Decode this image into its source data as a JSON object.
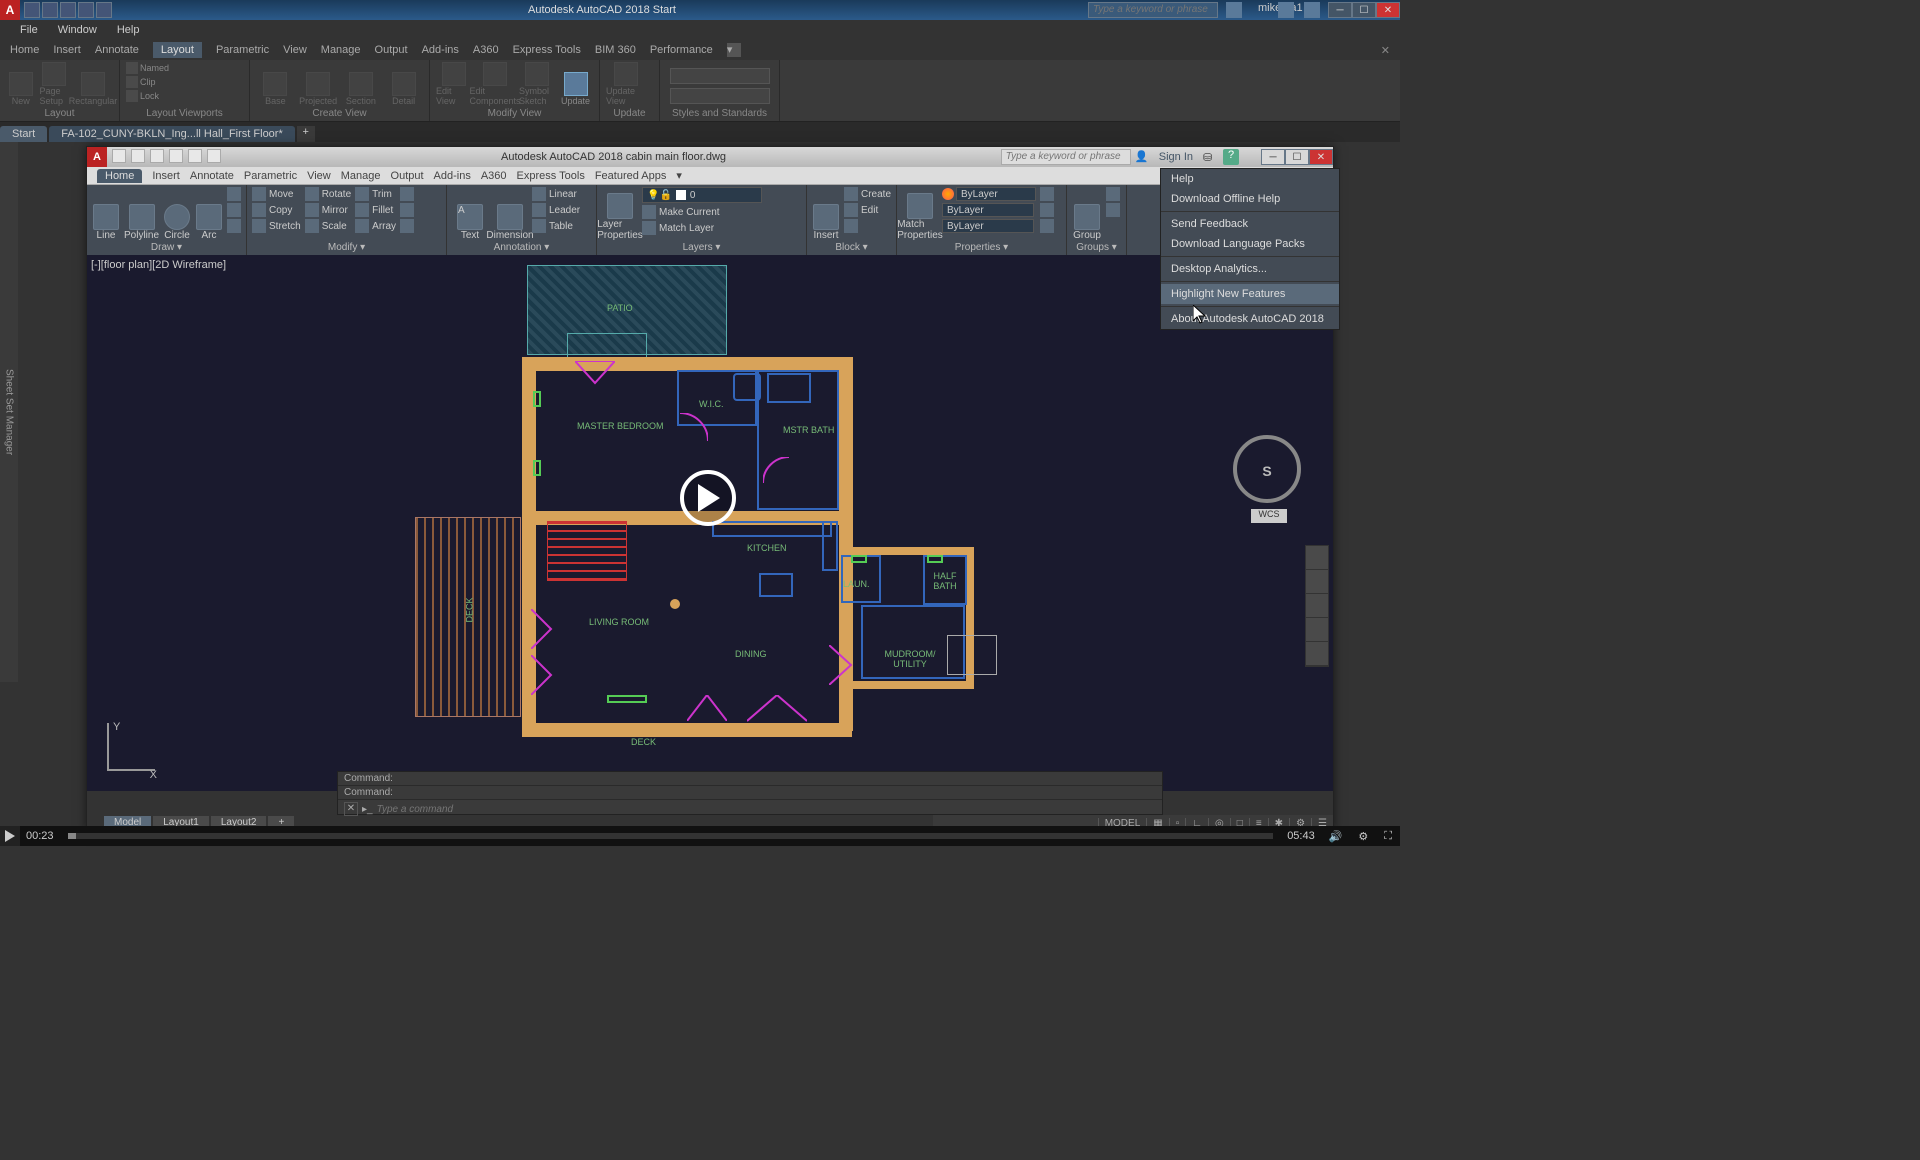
{
  "outer": {
    "title": "Autodesk AutoCAD 2018   Start",
    "search_ph": "Type a keyword or phrase",
    "user": "mikeafa1",
    "menus": [
      "File",
      "Window",
      "Help"
    ],
    "ribbon_tabs": [
      "Home",
      "Insert",
      "Annotate",
      "Layout",
      "Parametric",
      "View",
      "Manage",
      "Output",
      "Add-ins",
      "A360",
      "Express Tools",
      "BIM 360",
      "Performance"
    ],
    "ribbon_active": "Layout",
    "panels": {
      "layout": {
        "label": "Layout",
        "buttons": [
          "New",
          "Page Setup",
          "Rectangular"
        ]
      },
      "viewports": {
        "label": "Layout Viewports",
        "buttons": [
          "Clip",
          "Lock",
          "Named"
        ]
      },
      "createview": {
        "label": "Create View",
        "buttons": [
          "Base",
          "Projected",
          "Section",
          "Detail"
        ]
      },
      "modifyview": {
        "label": "Modify View",
        "buttons": [
          "Edit View",
          "Edit Components",
          "Symbol Sketch",
          "Update"
        ]
      },
      "update": {
        "label": "Update",
        "buttons": [
          "Update View"
        ]
      },
      "styles": {
        "label": "Styles and Standards"
      }
    },
    "doctabs": [
      "Start",
      "FA-102_CUNY-BKLN_Ing...ll Hall_First Floor*"
    ],
    "ssm": "Sheet Set Manager"
  },
  "inner": {
    "title": "Autodesk AutoCAD 2018      cabin main floor.dwg",
    "search_ph": "Type a keyword or phrase",
    "signin": "Sign In",
    "ribbon_tabs": [
      "Home",
      "Insert",
      "Annotate",
      "Parametric",
      "View",
      "Manage",
      "Output",
      "Add-ins",
      "A360",
      "Express Tools",
      "Featured Apps"
    ],
    "ribbon_active": "Home",
    "panels": {
      "draw": {
        "label": "Draw",
        "buttons": [
          "Line",
          "Polyline",
          "Circle",
          "Arc"
        ]
      },
      "modify": {
        "label": "Modify",
        "move": "Move",
        "copy": "Copy",
        "stretch": "Stretch",
        "rotate": "Rotate",
        "mirror": "Mirror",
        "scale": "Scale",
        "trim": "Trim",
        "fillet": "Fillet",
        "array": "Array"
      },
      "annotation": {
        "label": "Annotation",
        "text": "Text",
        "dim": "Dimension",
        "linear": "Linear",
        "leader": "Leader",
        "table": "Table"
      },
      "layers": {
        "label": "Layers",
        "big": "Layer Properties",
        "layer0": "0",
        "makecur": "Make Current",
        "matchlyr": "Match Layer"
      },
      "block": {
        "label": "Block",
        "insert": "Insert",
        "create": "Create",
        "edit": "Edit"
      },
      "properties": {
        "label": "Properties",
        "match": "Match Properties",
        "bylayer": "ByLayer"
      },
      "groups": {
        "label": "Groups",
        "group": "Group"
      }
    },
    "viewport_label": "[-][floor plan][2D Wireframe]",
    "rooms": {
      "patio": "PATIO",
      "master": "MASTER BEDROOM",
      "wic": "W.I.C.",
      "mstr_bath": "MSTR BATH",
      "kitchen": "KITCHEN",
      "laun": "LAUN.",
      "half": "HALF BATH",
      "living": "LIVING ROOM",
      "dining": "DINING",
      "mud": "MUDROOM/ UTILITY",
      "deck": "DECK",
      "deck2": "DECK"
    },
    "cmd_hist1": "Command:",
    "cmd_hist2": "Command:",
    "cmd_ph": "Type a command",
    "layout_tabs": [
      "Model",
      "Layout1",
      "Layout2"
    ],
    "status_model": "MODEL",
    "vcube": {
      "s": "S",
      "wcs": "WCS"
    },
    "ucs": {
      "y": "Y",
      "x": "X"
    }
  },
  "help_menu": [
    "Help",
    "Download Offline Help",
    "---",
    "Send Feedback",
    "Download Language Packs",
    "---",
    "Desktop Analytics...",
    "---",
    "Highlight New Features",
    "---",
    "About Autodesk AutoCAD 2018"
  ],
  "help_hover": "Highlight New Features",
  "player": {
    "current": "00:23",
    "total": "05:43",
    "volume": "vol"
  }
}
